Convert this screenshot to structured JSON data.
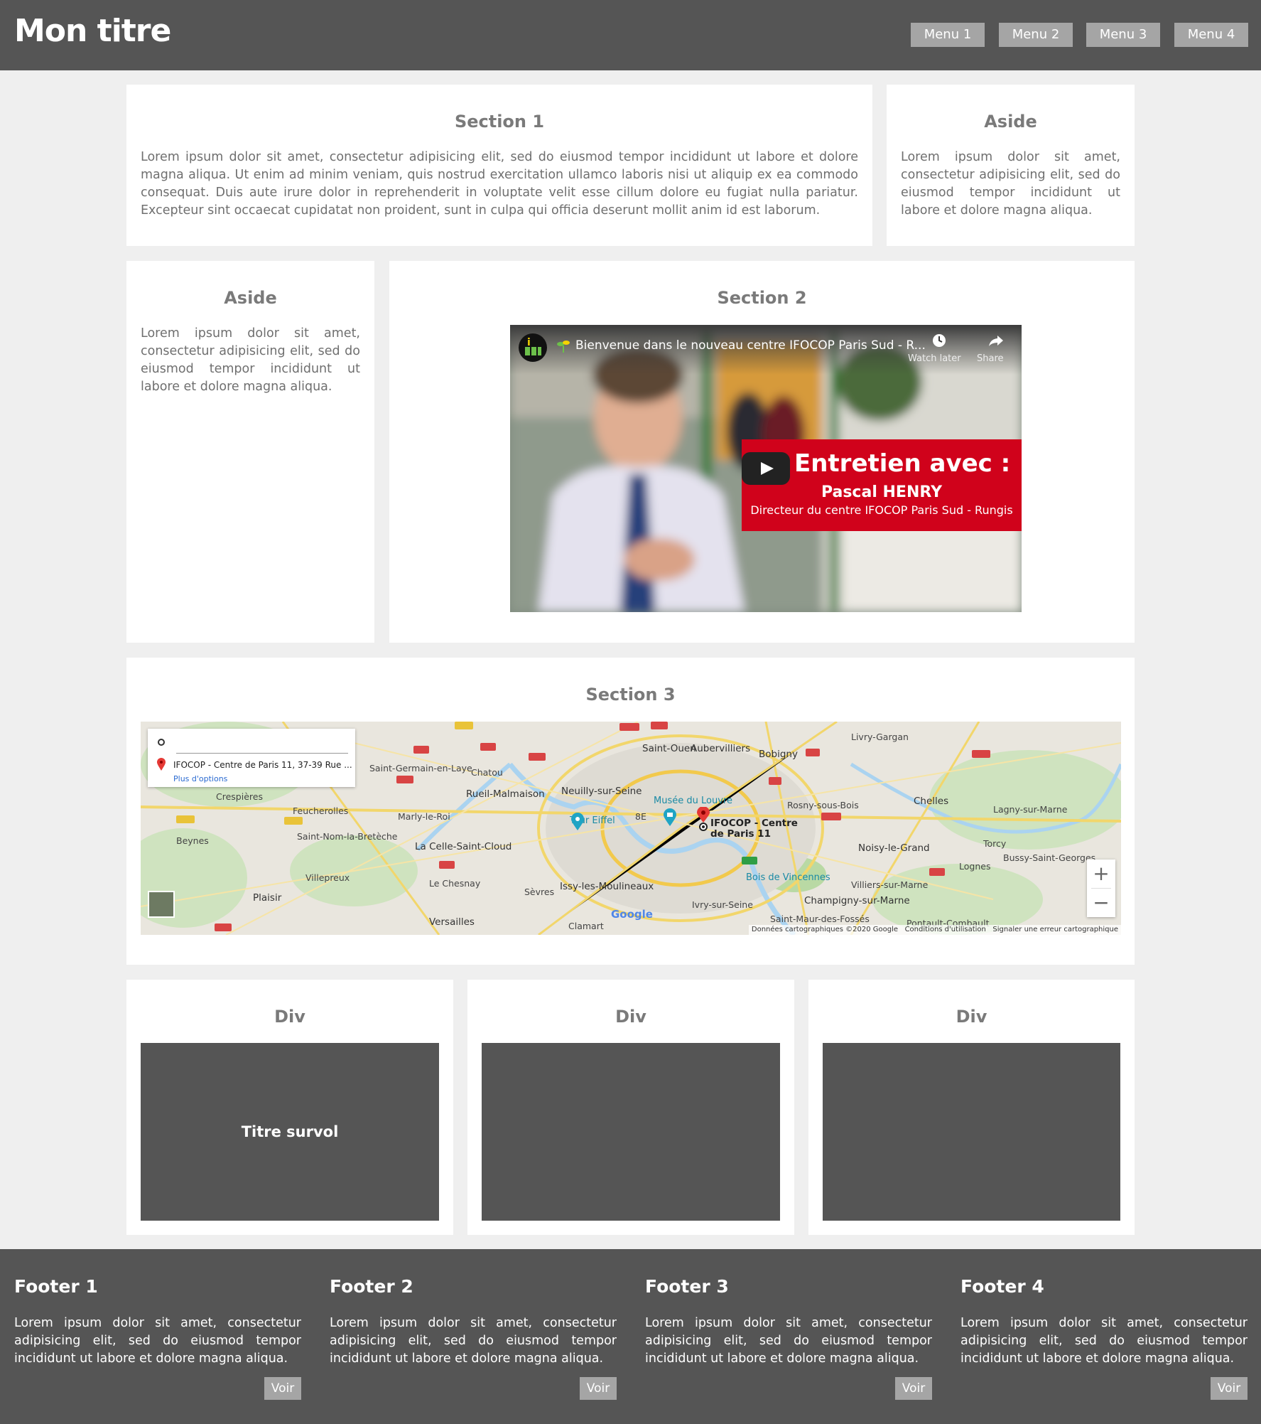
{
  "header": {
    "title": "Mon titre",
    "menu": [
      "Menu 1",
      "Menu 2",
      "Menu 3",
      "Menu 4"
    ]
  },
  "section1": {
    "title": "Section 1",
    "text": "Lorem ipsum dolor sit amet, consectetur adipisicing elit, sed do eiusmod tempor incididunt ut labore et dolore magna aliqua. Ut enim ad minim veniam, quis nostrud exercitation ullamco laboris nisi ut aliquip ex ea commodo consequat. Duis aute irure dolor in reprehenderit in voluptate velit esse cillum dolore eu fugiat nulla pariatur. Excepteur sint occaecat cupidatat non proident, sunt in culpa qui officia deserunt mollit anim id est laborum."
  },
  "aside_top": {
    "title": "Aside",
    "text": "Lorem ipsum dolor sit amet, consectetur adipisicing elit, sed do eiusmod tempor incididunt ut labore et dolore magna aliqua."
  },
  "aside_left": {
    "title": "Aside",
    "text": "Lorem ipsum dolor sit amet, consectetur adipisicing elit, sed do eiusmod tempor incididunt ut labore et dolore magna aliqua."
  },
  "section2": {
    "title": "Section 2",
    "video": {
      "title": "Bienvenue dans le nouveau centre IFOCOP Paris Sud - R...",
      "watch_later": "Watch later",
      "share": "Share",
      "banner_heading": "Entretien avec :",
      "banner_name": "Pascal HENRY",
      "banner_subtitle": "Directeur du centre IFOCOP Paris Sud - Rungis"
    }
  },
  "section3": {
    "title": "Section 3",
    "map": {
      "destination": "IFOCOP - Centre de Paris 11, 37-39 Rue ...",
      "more_options": "Plus d'options",
      "poi_name": "IFOCOP - Centre de Paris 11",
      "attribution": "Données cartographiques ©2020 Google",
      "terms": "Conditions d'utilisation",
      "report": "Signaler une erreur cartographique",
      "brand": "Google",
      "zoom_in": "+",
      "zoom_out": "−",
      "places": [
        "Saint-Ouen",
        "Aubervilliers",
        "Bobigny",
        "Livry-Gargan",
        "Saint-Germain-en-Laye",
        "Chatou",
        "Rueil-Malmaison",
        "Neuilly-sur-Seine",
        "Musée du Louvre",
        "Rosny-sous-Bois",
        "Chelles",
        "Lagny-sur-Marne",
        "Feucherolles",
        "Marly-le-Roi",
        "Tour Eiffel",
        "8E",
        "Saint-Nom-la-Bretèche",
        "La Celle-Saint-Cloud",
        "Noisy-le-Grand",
        "Torcy",
        "Bussy-Saint-Georges",
        "Beynes",
        "Villepreux",
        "Le Chesnay",
        "Sèvres",
        "Issy-les-Moulineaux",
        "Bois de Vincennes",
        "Villiers-sur-Marne",
        "Plaisir",
        "Versailles",
        "Clamart",
        "Ivry-sur-Seine",
        "Champigny-sur-Marne",
        "Saint-Maur-des-Fossés",
        "Pontault-Combault",
        "Crespières",
        "Lognes"
      ]
    }
  },
  "divs": [
    {
      "title": "Div",
      "hover_title": "Titre survol"
    },
    {
      "title": "Div",
      "hover_title": ""
    },
    {
      "title": "Div",
      "hover_title": ""
    }
  ],
  "footer": [
    {
      "title": "Footer 1",
      "text": "Lorem ipsum dolor sit amet, consectetur adipisicing elit, sed do eiusmod tempor incididunt ut labore et dolore magna aliqua.",
      "button": "Voir"
    },
    {
      "title": "Footer 2",
      "text": "Lorem ipsum dolor sit amet, consectetur adipisicing elit, sed do eiusmod tempor incididunt ut labore et dolore magna aliqua.",
      "button": "Voir"
    },
    {
      "title": "Footer 3",
      "text": "Lorem ipsum dolor sit amet, consectetur adipisicing elit, sed do eiusmod tempor incididunt ut labore et dolore magna aliqua.",
      "button": "Voir"
    },
    {
      "title": "Footer 4",
      "text": "Lorem ipsum dolor sit amet, consectetur adipisicing elit, sed do eiusmod tempor incididunt ut labore et dolore magna aliqua.",
      "button": "Voir"
    }
  ],
  "colors": {
    "header_bg": "#555555",
    "menu_button": "#a5a5a5",
    "page_bg": "#efefef",
    "card_bg": "#ffffff",
    "banner_red": "#d0021b"
  }
}
